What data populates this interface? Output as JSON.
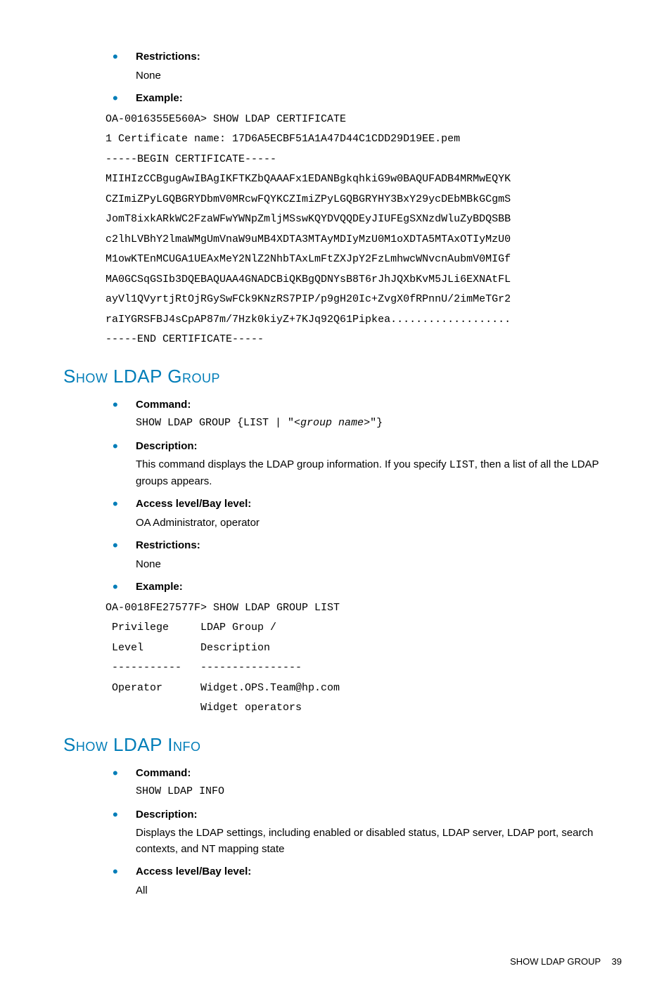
{
  "section0": {
    "items": [
      {
        "label": "Restrictions:",
        "body": "None"
      },
      {
        "label": "Example:"
      }
    ],
    "example": "OA-0016355E560A> SHOW LDAP CERTIFICATE\n1 Certificate name: 17D6A5ECBF51A1A47D44C1CDD29D19EE.pem\n-----BEGIN CERTIFICATE-----\nMIIHIzCCBgugAwIBAgIKFTKZbQAAAFx1EDANBgkqhkiG9w0BAQUFADB4MRMwEQYK\nCZImiZPyLGQBGRYDbmV0MRcwFQYKCZImiZPyLGQBGRYHY3BxY29ycDEbMBkGCgmS\nJomT8ixkARkWC2FzaWFwYWNpZmljMSswKQYDVQQDEyJIUFEgSXNzdWluZyBDQSBB\nc2lhLVBhY2lmaWMgUmVnaW9uMB4XDTA3MTAyMDIyMzU0M1oXDTA5MTAxOTIyMzU0\nM1owKTEnMCUGA1UEAxMeY2NlZ2NhbTAxLmFtZXJpY2FzLmhwcWNvcnAubmV0MIGf\nMA0GCSqGSIb3DQEBAQUAA4GNADCBiQKBgQDNYsB8T6rJhJQXbKvM5JLi6EXNAtFL\nayVl1QVyrtjRtOjRGySwFCk9KNzRS7PIP/p9gH20Ic+ZvgX0fRPnnU/2imMeTGr2\nraIYGRSFBJ4sCpAP87m/7Hzk0kiyZ+7KJq92Q61Pipkea...................\n-----END CERTIFICATE-----"
  },
  "section1": {
    "heading": "Show LDAP Group",
    "items": [
      {
        "label": "Command:",
        "mono": "SHOW LDAP GROUP {LIST | \"<group name>\"}",
        "monoPrefix": "SHOW LDAP GROUP {LIST | \"<",
        "monoItalic": "group name",
        "monoSuffix": ">\"}"
      },
      {
        "label": "Description:",
        "body": "This command displays the LDAP group information. If you specify ",
        "code": "LIST",
        "body2": ", then a list of all the LDAP groups appears."
      },
      {
        "label": "Access level/Bay level:",
        "body": "OA Administrator, operator"
      },
      {
        "label": "Restrictions:",
        "body": "None"
      },
      {
        "label": "Example:"
      }
    ],
    "example": "OA-0018FE27577F> SHOW LDAP GROUP LIST\n Privilege     LDAP Group /\n Level         Description\n -----------   ----------------\n Operator      Widget.OPS.Team@hp.com\n               Widget operators"
  },
  "section2": {
    "heading": "Show LDAP Info",
    "items": [
      {
        "label": "Command:",
        "mono": "SHOW LDAP INFO"
      },
      {
        "label": "Description:",
        "body": "Displays the LDAP settings, including enabled or disabled status, LDAP server, LDAP port, search contexts, and NT mapping state"
      },
      {
        "label": "Access level/Bay level:",
        "body": "All"
      }
    ]
  },
  "footer": {
    "section": "SHOW LDAP GROUP",
    "page": "39"
  }
}
